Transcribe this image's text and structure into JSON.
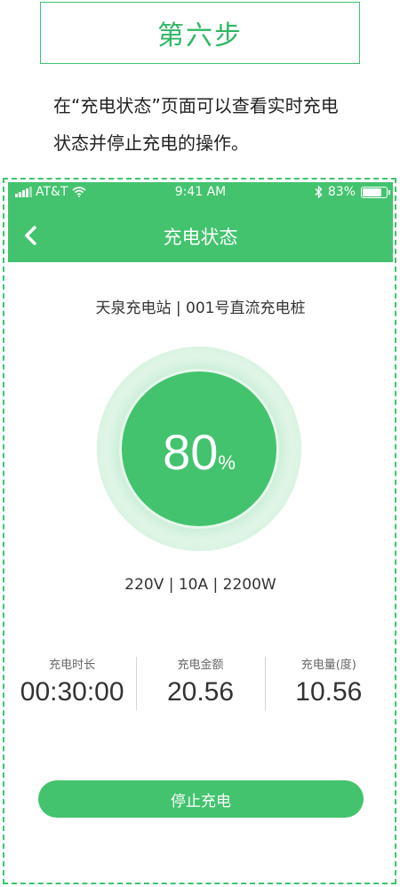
{
  "step": {
    "title": "第六步"
  },
  "instruction": {
    "text": "在“充电状态”页面可以查看实时充电状态并停止充电的操作。"
  },
  "phone": {
    "status_bar": {
      "carrier": "AT&T",
      "time": "9:41 AM",
      "battery": "83%"
    },
    "nav": {
      "title": "充电状态",
      "back_icon": "chevron-left-icon"
    },
    "station": "天泉充电站 | 001号直流充电桩",
    "gauge": {
      "value": "80",
      "unit": "%"
    },
    "specs": "220V | 10A | 2200W",
    "stats": [
      {
        "label": "充电时长",
        "value": "00:30:00"
      },
      {
        "label": "充电金额",
        "value": "20.56"
      },
      {
        "label": "充电量(度)",
        "value": "10.56"
      }
    ],
    "stop_button": "停止充电"
  },
  "colors": {
    "accent": "#43c36e",
    "frame": "#3ec46d"
  }
}
